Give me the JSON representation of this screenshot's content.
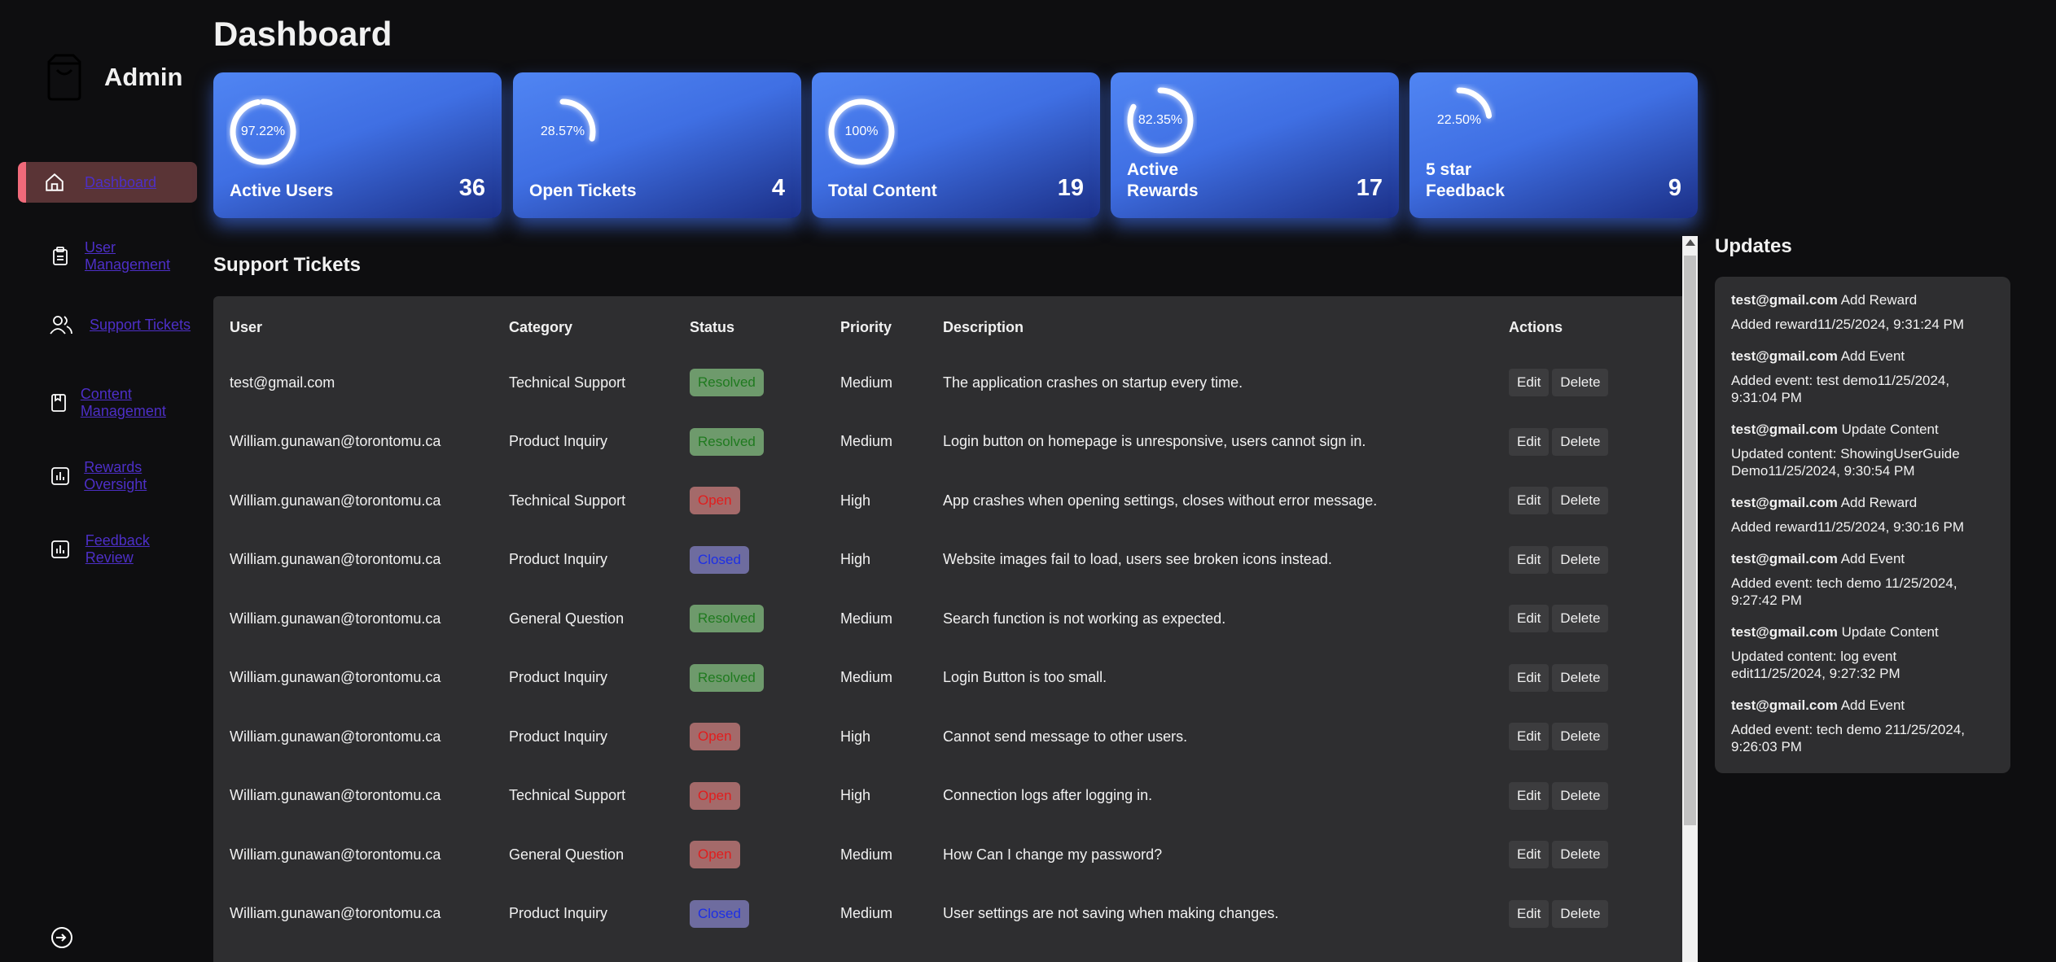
{
  "sidebar": {
    "brand_title": "Admin",
    "items": [
      {
        "label": "Dashboard",
        "icon": "home-icon"
      },
      {
        "label": "User Management",
        "icon": "clipboard-icon"
      },
      {
        "label": "Support Tickets",
        "icon": "users-icon"
      },
      {
        "label": "Content Management",
        "icon": "book-icon"
      },
      {
        "label": "Rewards Oversight",
        "icon": "chart-icon"
      },
      {
        "label": "Feedback Review",
        "icon": "chart-icon"
      }
    ],
    "logout_icon": "logout-icon"
  },
  "page_title": "Dashboard",
  "stats": [
    {
      "label": "Active Users",
      "value": "36",
      "pct_label": "97.22%",
      "pct": 0.9722
    },
    {
      "label": "Open Tickets",
      "value": "4",
      "pct_label": "28.57%",
      "pct": 0.2857
    },
    {
      "label": "Total Content",
      "value": "19",
      "pct_label": "100%",
      "pct": 1.0
    },
    {
      "label": "Active Rewards",
      "value": "17",
      "pct_label": "82.35%",
      "pct": 0.8235
    },
    {
      "label": "5 star Feedback",
      "value": "9",
      "pct_label": "22.50%",
      "pct": 0.225
    }
  ],
  "tickets": {
    "title": "Support Tickets",
    "columns": [
      "User",
      "Category",
      "Status",
      "Priority",
      "Description",
      "Actions"
    ],
    "edit_label": "Edit",
    "delete_label": "Delete",
    "rows": [
      {
        "user": "test@gmail.com",
        "category": "Technical Support",
        "status": "Resolved",
        "priority": "Medium",
        "description": "The application crashes on startup every time."
      },
      {
        "user": "William.gunawan@torontomu.ca",
        "category": "Product Inquiry",
        "status": "Resolved",
        "priority": "Medium",
        "description": "Login button on homepage is unresponsive, users cannot sign in."
      },
      {
        "user": "William.gunawan@torontomu.ca",
        "category": "Technical Support",
        "status": "Open",
        "priority": "High",
        "description": "App crashes when opening settings, closes without error message."
      },
      {
        "user": "William.gunawan@torontomu.ca",
        "category": "Product Inquiry",
        "status": "Closed",
        "priority": "High",
        "description": "Website images fail to load, users see broken icons instead."
      },
      {
        "user": "William.gunawan@torontomu.ca",
        "category": "General Question",
        "status": "Resolved",
        "priority": "Medium",
        "description": "Search function is not working as expected."
      },
      {
        "user": "William.gunawan@torontomu.ca",
        "category": "Product Inquiry",
        "status": "Resolved",
        "priority": "Medium",
        "description": "Login Button is too small."
      },
      {
        "user": "William.gunawan@torontomu.ca",
        "category": "Product Inquiry",
        "status": "Open",
        "priority": "High",
        "description": "Cannot send message to other users."
      },
      {
        "user": "William.gunawan@torontomu.ca",
        "category": "Technical Support",
        "status": "Open",
        "priority": "High",
        "description": "Connection logs after logging in."
      },
      {
        "user": "William.gunawan@torontomu.ca",
        "category": "General Question",
        "status": "Open",
        "priority": "Medium",
        "description": "How Can I change my password?"
      },
      {
        "user": "William.gunawan@torontomu.ca",
        "category": "Product Inquiry",
        "status": "Closed",
        "priority": "Medium",
        "description": "User settings are not saving when making changes."
      }
    ]
  },
  "updates": {
    "title": "Updates",
    "items": [
      {
        "user": "test@gmail.com",
        "action": "Add Reward",
        "detail": "Added reward11/25/2024, 9:31:24 PM"
      },
      {
        "user": "test@gmail.com",
        "action": "Add Event",
        "detail": "Added event: test demo11/25/2024, 9:31:04 PM"
      },
      {
        "user": "test@gmail.com",
        "action": "Update Content",
        "detail": "Updated content: ShowingUserGuide Demo11/25/2024, 9:30:54 PM"
      },
      {
        "user": "test@gmail.com",
        "action": "Add Reward",
        "detail": "Added reward11/25/2024, 9:30:16 PM"
      },
      {
        "user": "test@gmail.com",
        "action": "Add Event",
        "detail": "Added event: tech demo 11/25/2024, 9:27:42 PM"
      },
      {
        "user": "test@gmail.com",
        "action": "Update Content",
        "detail": "Updated content: log event edit11/25/2024, 9:27:32 PM"
      },
      {
        "user": "test@gmail.com",
        "action": "Add Event",
        "detail": "Added event: tech demo 211/25/2024, 9:26:03 PM"
      }
    ]
  },
  "colors": {
    "accent_active": "#f06a7a",
    "nav_link": "#4d2fc7",
    "card_blue": "#4f84f2",
    "resolved": "#1f7a1f",
    "open": "#e11d1d",
    "closed": "#1d2fe5"
  }
}
